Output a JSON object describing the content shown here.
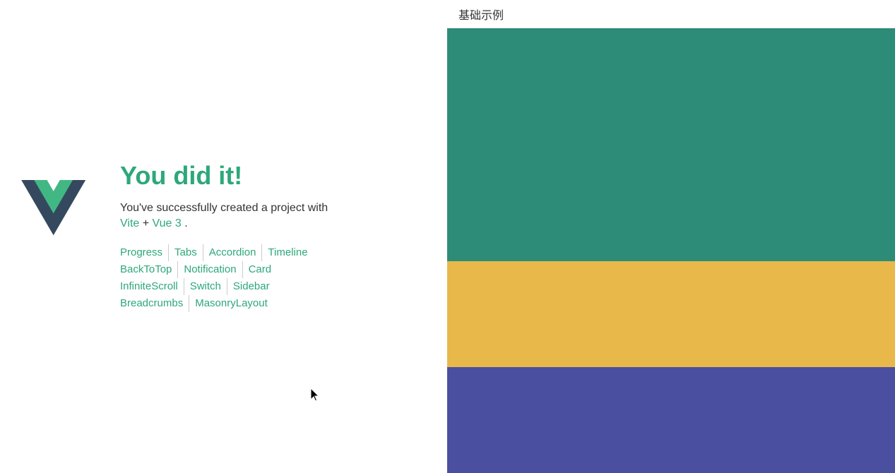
{
  "left": {
    "heading": "You did it!",
    "subtitle": "You've successfully created a project with",
    "links_text": "Vite + Vue 3.",
    "vite_label": "Vite",
    "vue_label": "Vue 3",
    "nav_rows": [
      [
        {
          "label": "Progress",
          "id": "progress"
        },
        {
          "label": "Tabs",
          "id": "tabs"
        },
        {
          "label": "Accordion",
          "id": "accordion"
        },
        {
          "label": "Timeline",
          "id": "timeline"
        }
      ],
      [
        {
          "label": "BackToTop",
          "id": "backtotop"
        },
        {
          "label": "Notification",
          "id": "notification"
        },
        {
          "label": "Card",
          "id": "card"
        }
      ],
      [
        {
          "label": "InfiniteScroll",
          "id": "infinitescroll"
        },
        {
          "label": "Switch",
          "id": "switch"
        },
        {
          "label": "Sidebar",
          "id": "sidebar"
        }
      ],
      [
        {
          "label": "Breadcrumbs",
          "id": "breadcrumbs"
        },
        {
          "label": "MasonryLayout",
          "id": "masonrylayout"
        }
      ]
    ]
  },
  "right": {
    "section_title": "基础示例",
    "colors": {
      "teal": "#2d8c78",
      "yellow": "#e8b84b",
      "purple": "#4b4fa0"
    }
  }
}
